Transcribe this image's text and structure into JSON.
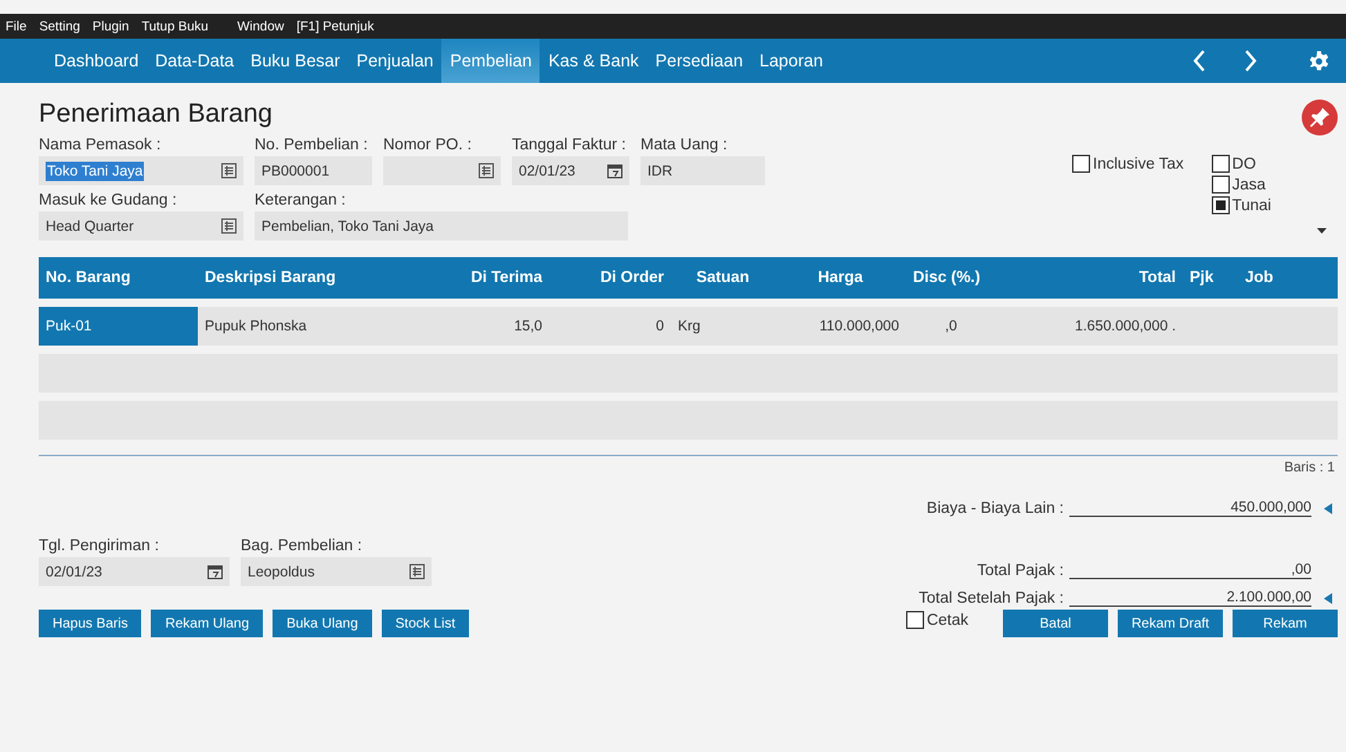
{
  "menu_bar": [
    "File",
    "Setting",
    "Plugin",
    "Tutup Buku",
    "Window",
    "[F1] Petunjuk"
  ],
  "nav": {
    "tabs": [
      {
        "label": "Dashboard",
        "selected": false
      },
      {
        "label": "Data-Data",
        "selected": false
      },
      {
        "label": "Buku Besar",
        "selected": false
      },
      {
        "label": "Penjualan",
        "selected": false
      },
      {
        "label": "Pembelian",
        "selected": true
      },
      {
        "label": "Kas & Bank",
        "selected": false
      },
      {
        "label": "Persediaan",
        "selected": false
      },
      {
        "label": "Laporan",
        "selected": false
      }
    ]
  },
  "form": {
    "title": "Penerimaan Barang",
    "fields_row_1": [
      {
        "kind": "list",
        "label": "Nama Pemasok :",
        "value": "Toko Tani Jaya",
        "highlighted": true
      },
      {
        "kind": "text",
        "label": "No. Pembelian :",
        "value": "PB000001"
      },
      {
        "kind": "list",
        "label": "Nomor PO. :"
      },
      {
        "kind": "date",
        "label": "Tanggal Faktur :",
        "value": "02/01/23"
      },
      {
        "kind": "text",
        "label": "Mata Uang :",
        "value": "IDR"
      }
    ],
    "fields_row_2": [
      {
        "kind": "list",
        "label": "Masuk ke Gudang :",
        "value": "Head Quarter"
      },
      {
        "kind": "text",
        "label": "Keterangan :",
        "value": "Pembelian, Toko Tani Jaya"
      }
    ],
    "inclusive_tax": {
      "label": "Inclusive Tax",
      "checked": false
    },
    "options": [
      {
        "label": "DO",
        "checked": false
      },
      {
        "label": "Jasa",
        "checked": false
      },
      {
        "label": "Tunai",
        "checked": true
      }
    ]
  },
  "table": {
    "columns": [
      "No. Barang",
      "Deskripsi Barang",
      "Di Terima",
      "Di Order",
      "Satuan",
      "Harga",
      "Disc (%.)",
      "Total",
      "Pjk",
      "Job"
    ],
    "rows": [
      {
        "selected": true,
        "cells": [
          "Puk-01",
          "Pupuk Phonska",
          "15,0",
          "0",
          "Krg",
          "110.000,000",
          ",0",
          "1.650.000,000 ."
        ]
      }
    ],
    "row_count": "Baris : 1"
  },
  "other_costs": {
    "label": "Biaya - Biaya Lain :",
    "value": "450.000,000",
    "marker": true
  },
  "shipping": [
    {
      "kind": "date",
      "label": "Tgl. Pengiriman :",
      "value": "02/01/23"
    },
    {
      "kind": "list",
      "label": "Bag. Pembelian :",
      "value": "Leopoldus"
    }
  ],
  "totals": [
    {
      "label": "Total Pajak :",
      "value": ",00",
      "marker": false
    },
    {
      "label": "Total Setelah Pajak :",
      "value": "2.100.000,00",
      "marker": true
    }
  ],
  "left_buttons": [
    "Hapus Baris",
    "Rekam Ulang",
    "Buka Ulang",
    "Stock List"
  ],
  "print": {
    "label": "Cetak",
    "checked": false
  },
  "right_buttons": [
    "Batal",
    "Rekam Draft",
    "Rekam"
  ]
}
